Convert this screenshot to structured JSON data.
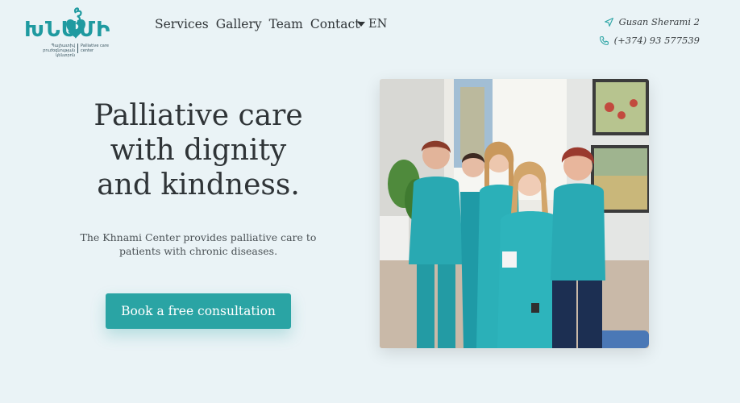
{
  "header": {
    "logo": {
      "wordmark": "ԽՆԱՄԻ",
      "armenian_subtitle": "Պալիատիվ բուժօգնության կենտրոն",
      "english_subtitle": "Palliative care center"
    },
    "nav": [
      {
        "label": "Services"
      },
      {
        "label": "Gallery"
      },
      {
        "label": "Team"
      },
      {
        "label": "Contact"
      }
    ],
    "language": "EN",
    "address": "Gusan Sherami 2",
    "phone": "(+374) 93 577539"
  },
  "hero": {
    "title_lines": [
      "Palliative care",
      "with dignity",
      "and kindness."
    ],
    "description_lines": [
      "The Khnami Center provides palliative care to",
      "patients with chronic diseases."
    ],
    "cta_label": "Book a free consultation"
  },
  "icons": {
    "address": "location-arrow-icon",
    "phone": "phone-icon",
    "language": "caret-down-icon"
  },
  "colors": {
    "brand": "#2aa4a4",
    "background": "#eaf3f6",
    "text": "#2f3437"
  }
}
